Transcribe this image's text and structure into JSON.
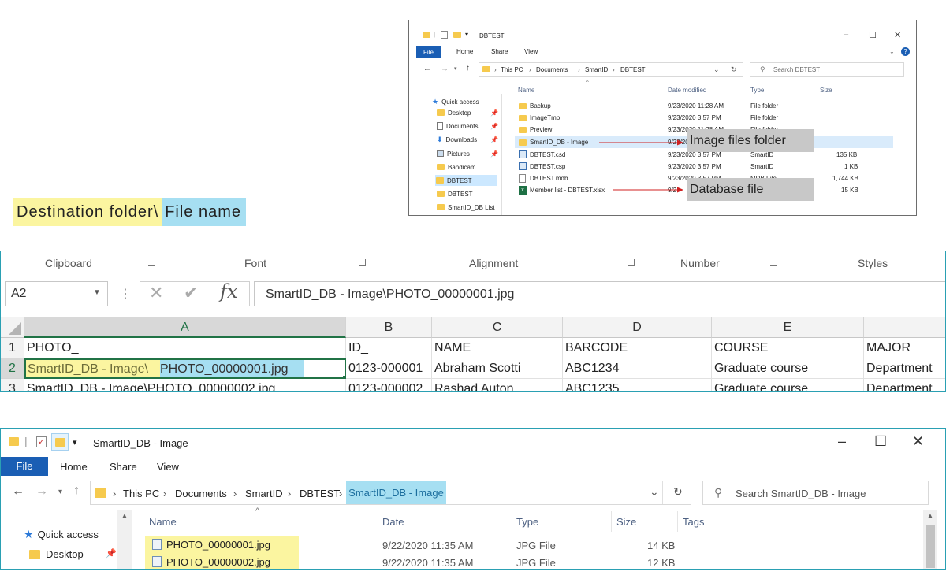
{
  "annotation": {
    "destination": "Destination folder\\",
    "file_name": "File name"
  },
  "callouts": {
    "image_folder": "Image files folder",
    "database_file": "Database file"
  },
  "mini_explorer": {
    "title": "DBTEST",
    "ribbon_tabs": [
      "File",
      "Home",
      "Share",
      "View"
    ],
    "path": [
      "This PC",
      "Documents",
      "SmartID",
      "DBTEST"
    ],
    "search_placeholder": "Search DBTEST",
    "columns": [
      "Name",
      "Date modified",
      "Type",
      "Size"
    ],
    "nav": [
      {
        "label": "Quick access"
      },
      {
        "label": "Desktop"
      },
      {
        "label": "Documents"
      },
      {
        "label": "Downloads"
      },
      {
        "label": "Pictures"
      },
      {
        "label": "Bandicam"
      },
      {
        "label": "DBTEST"
      },
      {
        "label": "DBTEST"
      },
      {
        "label": "SmartID_DB List"
      }
    ],
    "files": [
      {
        "name": "Backup",
        "date": "9/23/2020 11:28 AM",
        "type": "File folder",
        "size": ""
      },
      {
        "name": "ImageTmp",
        "date": "9/23/2020 3:57 PM",
        "type": "File folder",
        "size": ""
      },
      {
        "name": "Preview",
        "date": "9/23/2020 11:28 AM",
        "type": "File folder",
        "size": ""
      },
      {
        "name": "SmartID_DB - Image",
        "date": "9/23/2020",
        "type": "",
        "size": ""
      },
      {
        "name": "DBTEST.csd",
        "date": "9/23/2020 3:57 PM",
        "type": "SmartID",
        "size": "135 KB"
      },
      {
        "name": "DBTEST.csp",
        "date": "9/23/2020 3:57 PM",
        "type": "SmartID",
        "size": "1 KB"
      },
      {
        "name": "DBTEST.mdb",
        "date": "9/23/2020 3:57 PM",
        "type": "MDB File",
        "size": "1,744 KB"
      },
      {
        "name": "Member list - DBTEST.xlsx",
        "date": "9/2",
        "type": "",
        "size": "15 KB"
      }
    ]
  },
  "excel": {
    "ribbon_groups": [
      "Clipboard",
      "Font",
      "Alignment",
      "Number",
      "Styles"
    ],
    "name_box": "A2",
    "formula": "SmartID_DB - Image\\PHOTO_00000001.jpg",
    "columns": [
      "A",
      "B",
      "C",
      "D",
      "E"
    ],
    "rows": [
      {
        "num": "1",
        "cells": [
          "PHOTO_",
          "ID_",
          "NAME",
          "BARCODE",
          "COURSE",
          "MAJOR"
        ]
      },
      {
        "num": "2",
        "a_folder": "SmartID_DB - Image\\",
        "a_file": "PHOTO_00000001.jpg",
        "cells": [
          "0123-000001",
          "Abraham Scotti",
          "ABC1234",
          "Graduate course",
          "Department"
        ]
      },
      {
        "num": "3",
        "cells": [
          "SmartID_DB - Image\\PHOTO_00000002.jpg",
          "0123-000002",
          "Rashad Auton",
          "ABC1235",
          "Graduate course",
          "Department"
        ]
      }
    ]
  },
  "big_explorer": {
    "title": "SmartID_DB - Image",
    "ribbon_tabs": [
      "File",
      "Home",
      "Share",
      "View"
    ],
    "path": [
      "This PC",
      "Documents",
      "SmartID",
      "DBTEST",
      "SmartID_DB - Image"
    ],
    "search_placeholder": "Search SmartID_DB - Image",
    "columns": [
      "Name",
      "Date",
      "Type",
      "Size",
      "Tags"
    ],
    "nav": [
      {
        "label": "Quick access"
      },
      {
        "label": "Desktop"
      }
    ],
    "files": [
      {
        "name": "PHOTO_00000001.jpg",
        "date": "9/22/2020 11:35 AM",
        "type": "JPG File",
        "size": "14 KB"
      },
      {
        "name": "PHOTO_00000002.jpg",
        "date": "9/22/2020 11:35 AM",
        "type": "JPG File",
        "size": "12 KB"
      }
    ]
  }
}
